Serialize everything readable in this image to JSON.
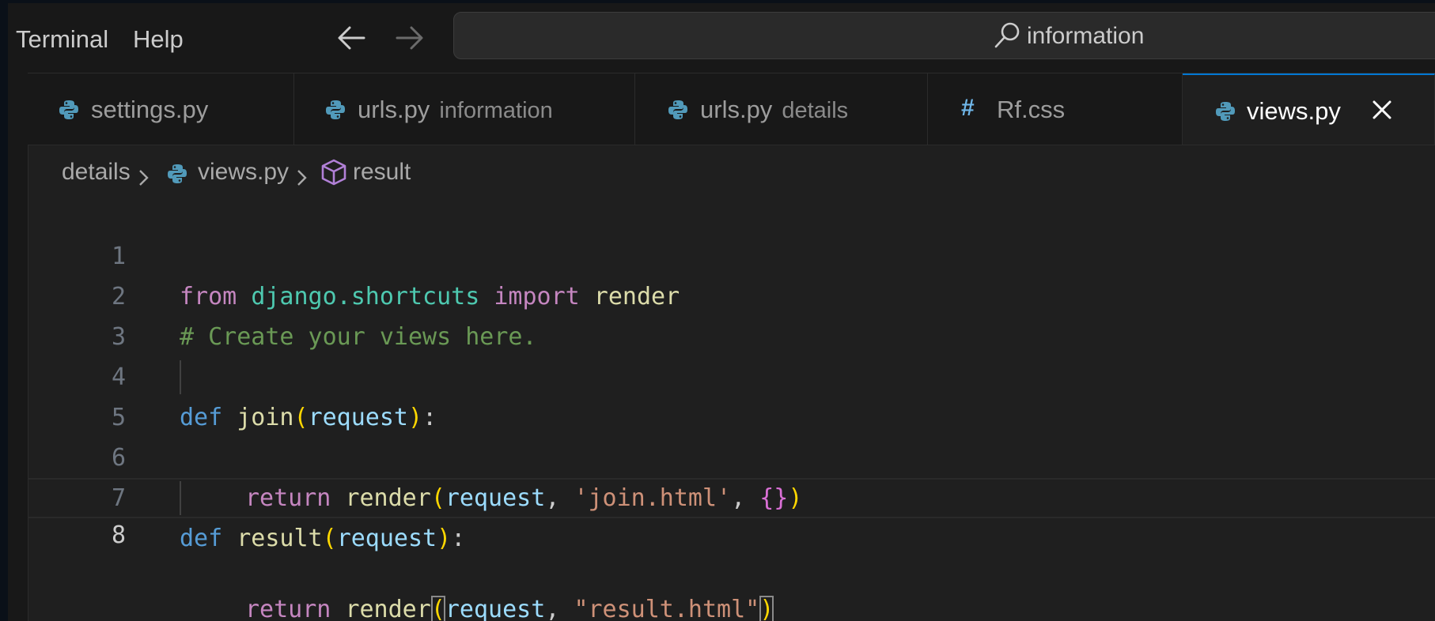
{
  "menu": {
    "terminal": "Terminal",
    "help": "Help"
  },
  "nav": {
    "back_icon": "arrow-left-icon",
    "forward_icon": "arrow-right-icon"
  },
  "search": {
    "icon": "search-icon",
    "text": "information"
  },
  "tabs": [
    {
      "label": "settings.py",
      "description": "",
      "icon": "python-icon",
      "active": false
    },
    {
      "label": "urls.py",
      "description": "information",
      "icon": "python-icon",
      "active": false
    },
    {
      "label": "urls.py",
      "description": "details",
      "icon": "python-icon",
      "active": false
    },
    {
      "label": "Rf.css",
      "description": "",
      "icon": "hash-icon",
      "hash_glyph": "#",
      "active": false
    },
    {
      "label": "views.py",
      "description": "",
      "icon": "python-icon",
      "active": true
    }
  ],
  "breadcrumb": {
    "folder": "details",
    "file": "views.py",
    "symbol": "result"
  },
  "editor": {
    "line_numbers": [
      "1",
      "2",
      "3",
      "4",
      "5",
      "6",
      "7",
      "8"
    ],
    "current_line": 8,
    "lines": {
      "l1": {
        "from": "from",
        "module": "django.shortcuts",
        "import": "import",
        "name": "render"
      },
      "l2": {
        "comment": "# Create your views here."
      },
      "l4": {
        "def": "def",
        "fn": "join",
        "open": "(",
        "param": "request",
        "close": ")",
        "colon": ":"
      },
      "l5": {
        "return": "return",
        "fn": "render",
        "open": "(",
        "param": "request",
        "comma1": ", ",
        "str": "'join.html'",
        "comma2": ", ",
        "dict": "{}",
        "close": ")"
      },
      "l7": {
        "def": "def",
        "fn": "result",
        "open": "(",
        "param": "request",
        "close": ")",
        "colon": ":"
      },
      "l8": {
        "return": "return",
        "fn": "render",
        "open": "(",
        "param": "request",
        "comma1": ", ",
        "str": "\"result.html\"",
        "close": ")"
      }
    }
  },
  "colors": {
    "accent": "#0078d4",
    "keyword": "#c586c0",
    "def": "#569cd6",
    "module": "#4ec9b0",
    "function": "#dcdcaa",
    "param": "#9cdcfe",
    "string": "#ce9178",
    "comment": "#6a9955",
    "python_icon": "#519aba"
  }
}
